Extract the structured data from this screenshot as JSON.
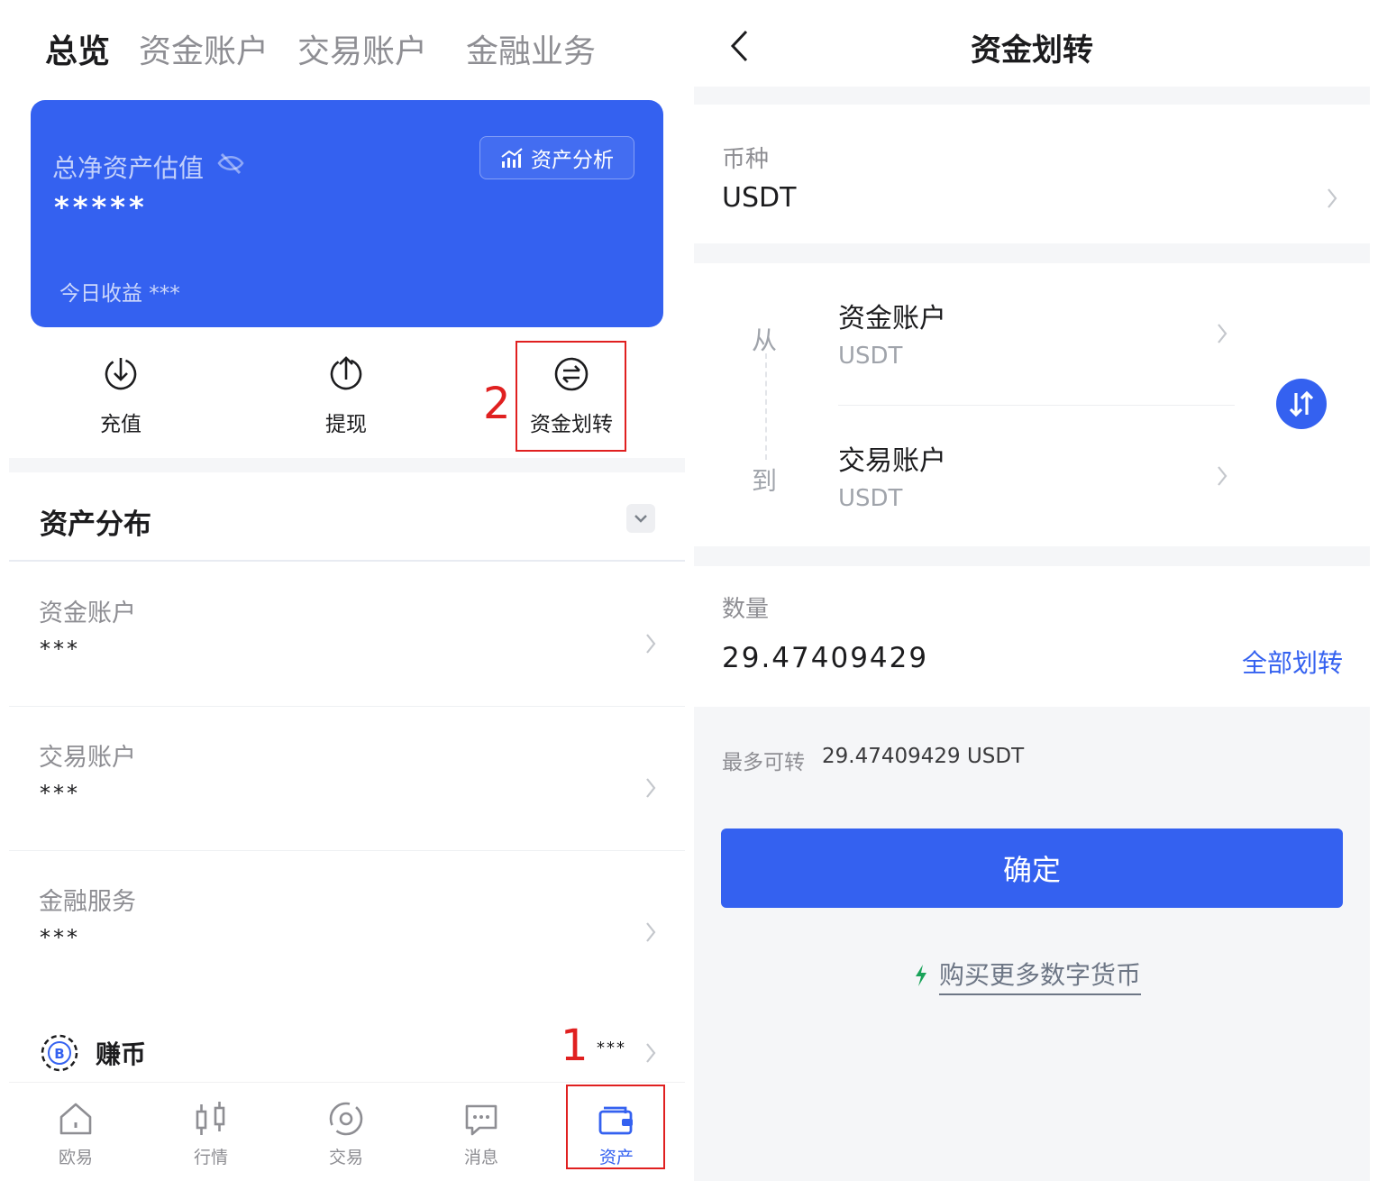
{
  "left": {
    "top_tabs": [
      "总览",
      "资金账户",
      "交易账户",
      "金融业务"
    ],
    "card": {
      "label": "总净资产估值",
      "value": "*****",
      "analysis_label": "资产分析",
      "today_label": "今日收益 ***"
    },
    "actions": [
      {
        "label": "充值",
        "icon": "deposit-icon"
      },
      {
        "label": "提现",
        "icon": "withdraw-icon"
      },
      {
        "label": "资金划转",
        "icon": "transfer-icon"
      }
    ],
    "distribution": {
      "title": "资产分布",
      "rows": [
        {
          "name": "资金账户",
          "value": "***"
        },
        {
          "name": "交易账户",
          "value": "***"
        },
        {
          "name": "金融服务",
          "value": "***"
        }
      ]
    },
    "earn": {
      "label": "赚币",
      "value": "***"
    },
    "nav": [
      {
        "label": "欧易",
        "icon": "home-icon"
      },
      {
        "label": "行情",
        "icon": "candlestick-icon"
      },
      {
        "label": "交易",
        "icon": "trade-icon"
      },
      {
        "label": "消息",
        "icon": "message-icon"
      },
      {
        "label": "资产",
        "icon": "wallet-icon"
      }
    ],
    "annotations": {
      "step1": "1",
      "step2": "2",
      "color": "#e02020"
    }
  },
  "right": {
    "title": "资金划转",
    "coin_label": "币种",
    "coin_value": "USDT",
    "from_label": "从",
    "to_label": "到",
    "from_account": "资金账户",
    "from_coin": "USDT",
    "to_account": "交易账户",
    "to_coin": "USDT",
    "amount_label": "数量",
    "amount_value": "29.47409429",
    "all_transfer": "全部划转",
    "max_label": "最多可转",
    "max_value": "29.47409429 USDT",
    "confirm": "确定",
    "buy_more": "购买更多数字货币"
  },
  "colors": {
    "accent": "#3461f0",
    "bolt": "#1aa35a"
  }
}
